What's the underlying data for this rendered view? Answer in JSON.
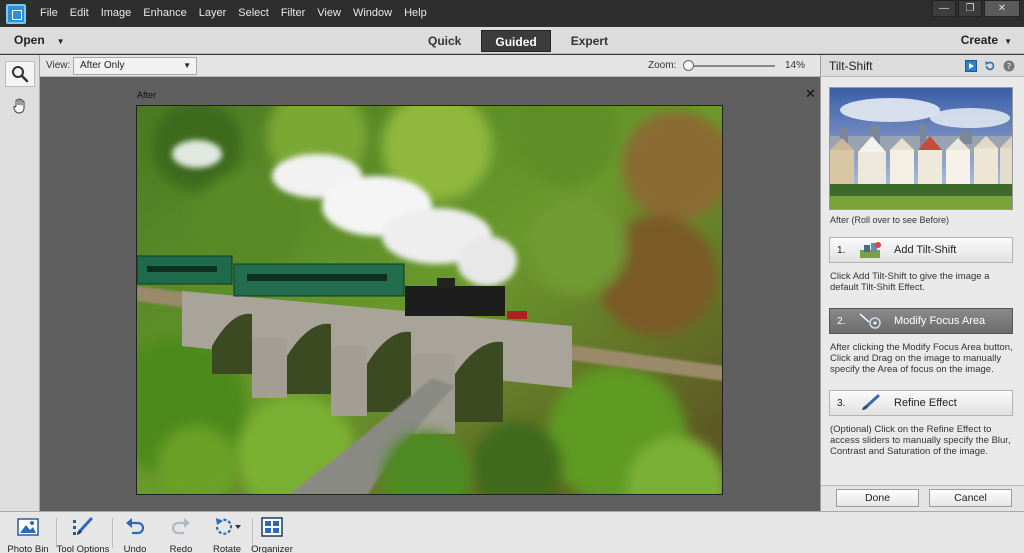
{
  "menu": [
    "File",
    "Edit",
    "Image",
    "Enhance",
    "Layer",
    "Select",
    "Filter",
    "View",
    "Window",
    "Help"
  ],
  "window_controls": {
    "minimize": "—",
    "restore": "❐",
    "close": "✕"
  },
  "modebar": {
    "open_label": "Open",
    "tabs": [
      "Quick",
      "Guided",
      "Expert"
    ],
    "active_tab": "Guided",
    "create_label": "Create"
  },
  "viewbar": {
    "view_label": "View:",
    "view_value": "After Only",
    "zoom_label": "Zoom:",
    "zoom_value": "14%",
    "zoom_fraction": 0.0
  },
  "canvas": {
    "after_label": "After",
    "close_glyph": "✕"
  },
  "panel": {
    "title": "Tilt-Shift",
    "thumb_caption": "After (Roll over to see Before)",
    "steps": [
      {
        "num": "1.",
        "label": "Add Tilt-Shift",
        "desc": "Click Add Tilt-Shift to give the image a default Tilt-Shift Effect."
      },
      {
        "num": "2.",
        "label": "Modify Focus Area",
        "desc": "After clicking the Modify Focus Area button, Click and Drag on the image to manually specify the Area of focus on the image."
      },
      {
        "num": "3.",
        "label": "Refine Effect",
        "desc": "(Optional) Click on the Refine Effect to access sliders to manually specify the Blur, Contrast and Saturation of the image."
      }
    ],
    "active_step": 1,
    "done_label": "Done",
    "cancel_label": "Cancel"
  },
  "bottombar": {
    "items": [
      "Photo Bin",
      "Tool Options",
      "Undo",
      "Redo",
      "Rotate",
      "Organizer"
    ]
  }
}
